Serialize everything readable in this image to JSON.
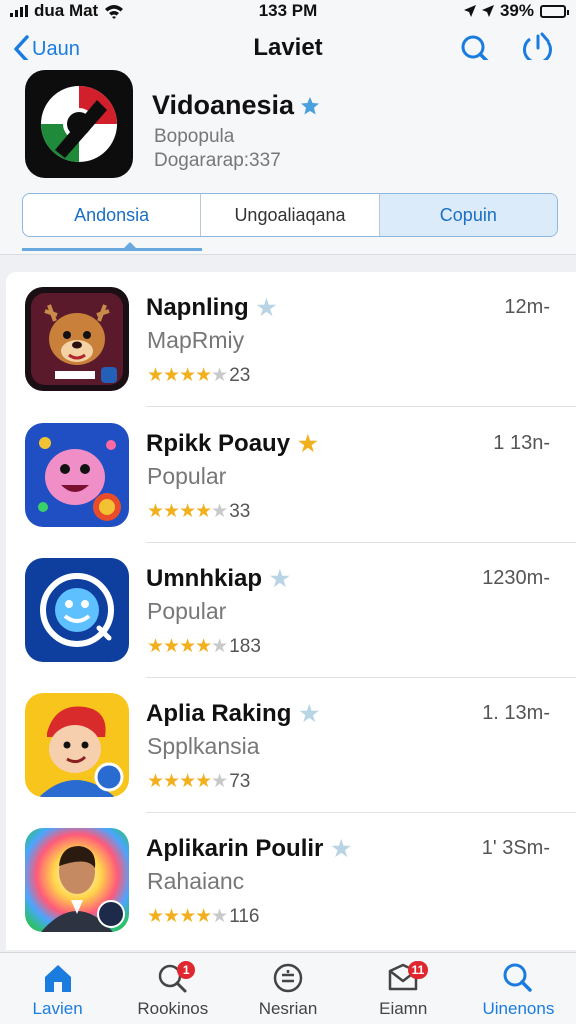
{
  "status_bar": {
    "carrier": "dua Mat",
    "time": "133 PM",
    "battery": "39%",
    "battery_level": 0.39
  },
  "header": {
    "back_label": "Uaun",
    "title": "Laviet"
  },
  "app": {
    "name": "Vidoanesia",
    "subtitle": "Bopopula",
    "meta": "Dogararap:337",
    "segments": [
      "Andonsia",
      "Ungoaliaqana",
      "Copuin"
    ]
  },
  "list": [
    {
      "title": "Napnling",
      "subtitle": "MapRmiy",
      "rating_count": "23",
      "meta": "12m-",
      "badge_color": "#b9d4e4"
    },
    {
      "title": "Rpikk Poauy",
      "subtitle": "Popular",
      "rating_count": "33",
      "meta": "1 13n-",
      "badge_color": "#f2b01e"
    },
    {
      "title": "Umnhkiap",
      "subtitle": "Popular",
      "rating_count": "183",
      "meta": "1230m-",
      "badge_color": "#b9d4e4"
    },
    {
      "title": "Aplia Raking",
      "subtitle": "Spplkansia",
      "rating_count": "73",
      "meta": "1. 13m-",
      "badge_color": "#b9d4e4"
    },
    {
      "title": "Aplikarin Poulir",
      "subtitle": "Rahaianc",
      "rating_count": "116",
      "meta": "1' 3Sm-",
      "badge_color": "#b9d4e4"
    }
  ],
  "tabs": [
    {
      "label": "Lavien",
      "icon": "home-icon",
      "active": true
    },
    {
      "label": "Rookinos",
      "icon": "search-badge-icon",
      "badge": "1"
    },
    {
      "label": "Nesrian",
      "icon": "equals-circle-icon"
    },
    {
      "label": "Eiamn",
      "icon": "inbox-icon",
      "badge": "11"
    },
    {
      "label": "Uinenons",
      "icon": "search-icon"
    }
  ],
  "colors": {
    "accent": "#1b7ce0",
    "star": "#f2b01e",
    "badge": "#e0262f"
  }
}
